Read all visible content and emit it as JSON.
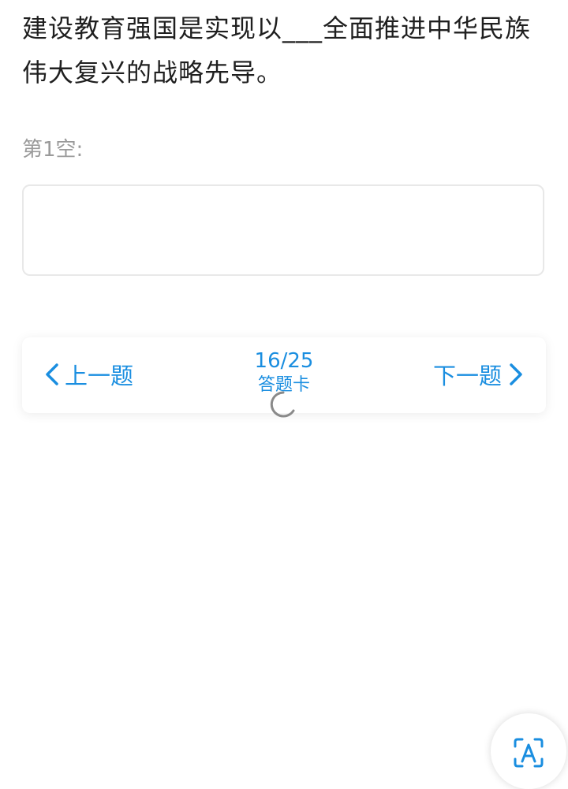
{
  "question": {
    "text": "建设教育强国是实现以___全面推进中华民族伟大复兴的战略先导。"
  },
  "blank": {
    "label": "第1空:",
    "value": "",
    "placeholder": ""
  },
  "navigation": {
    "prev_label": "上一题",
    "next_label": "下一题",
    "progress": "16/25",
    "answer_card_label": "答题卡"
  },
  "icons": {
    "prev": "chevron-left-icon",
    "next": "chevron-right-icon",
    "loading": "loading-spinner-icon",
    "scan": "text-recognition-icon"
  },
  "colors": {
    "accent": "#1a8ee0",
    "label_gray": "#9a9a9a",
    "text": "#1f1f1f"
  }
}
